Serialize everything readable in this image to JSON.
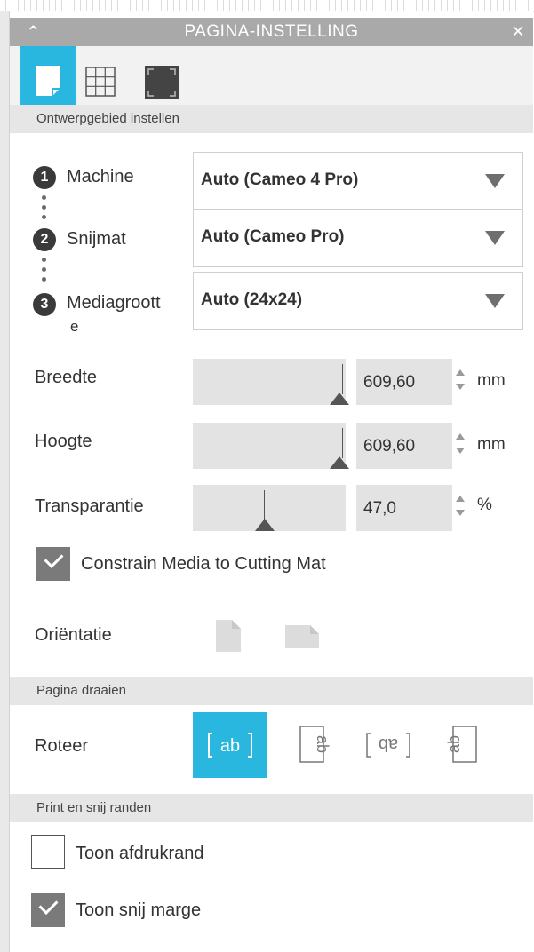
{
  "window": {
    "title": "PAGINA-INSTELLING",
    "collapse_icon": "chevron-up-icon",
    "close_icon": "close-icon"
  },
  "tabs": [
    {
      "icon": "page-setup-icon",
      "active": true
    },
    {
      "icon": "grid-icon",
      "active": false
    },
    {
      "icon": "registration-marks-icon",
      "active": false
    }
  ],
  "design_area": {
    "header": "Ontwerpgebied instellen",
    "machine": {
      "step": "1",
      "label": "Machine",
      "value": "Auto (Cameo 4 Pro)"
    },
    "mat": {
      "step": "2",
      "label": "Snijmat",
      "value": "Auto (Cameo Pro)"
    },
    "media": {
      "step": "3",
      "label_line1": "Mediagroott",
      "label_line2": "e",
      "value": "Auto (24x24)"
    },
    "width": {
      "label": "Breedte",
      "value": "609,60",
      "unit": "mm"
    },
    "height": {
      "label": "Hoogte",
      "value": "609,60",
      "unit": "mm"
    },
    "transparency": {
      "label": "Transparantie",
      "value": "47,0",
      "unit": "%"
    },
    "constrain": {
      "label": "Constrain Media to Cutting Mat",
      "checked": true
    },
    "orientation": {
      "label": "Oriëntatie"
    }
  },
  "rotate": {
    "header": "Pagina draaien",
    "label": "Roteer",
    "options": [
      {
        "icon": "rotate-0-icon",
        "active": true
      },
      {
        "icon": "rotate-90-icon",
        "active": false
      },
      {
        "icon": "rotate-180-icon",
        "active": false
      },
      {
        "icon": "rotate-270-icon",
        "active": false
      }
    ]
  },
  "print_cut": {
    "header": "Print en snij randen",
    "show_print_border": {
      "label": "Toon afdrukrand",
      "checked": false
    },
    "show_cut_margin": {
      "label": "Toon snij marge",
      "checked": true
    }
  },
  "colors": {
    "accent": "#29b6df",
    "titlebar": "#a9a9a9",
    "section": "#e6e6e6"
  }
}
